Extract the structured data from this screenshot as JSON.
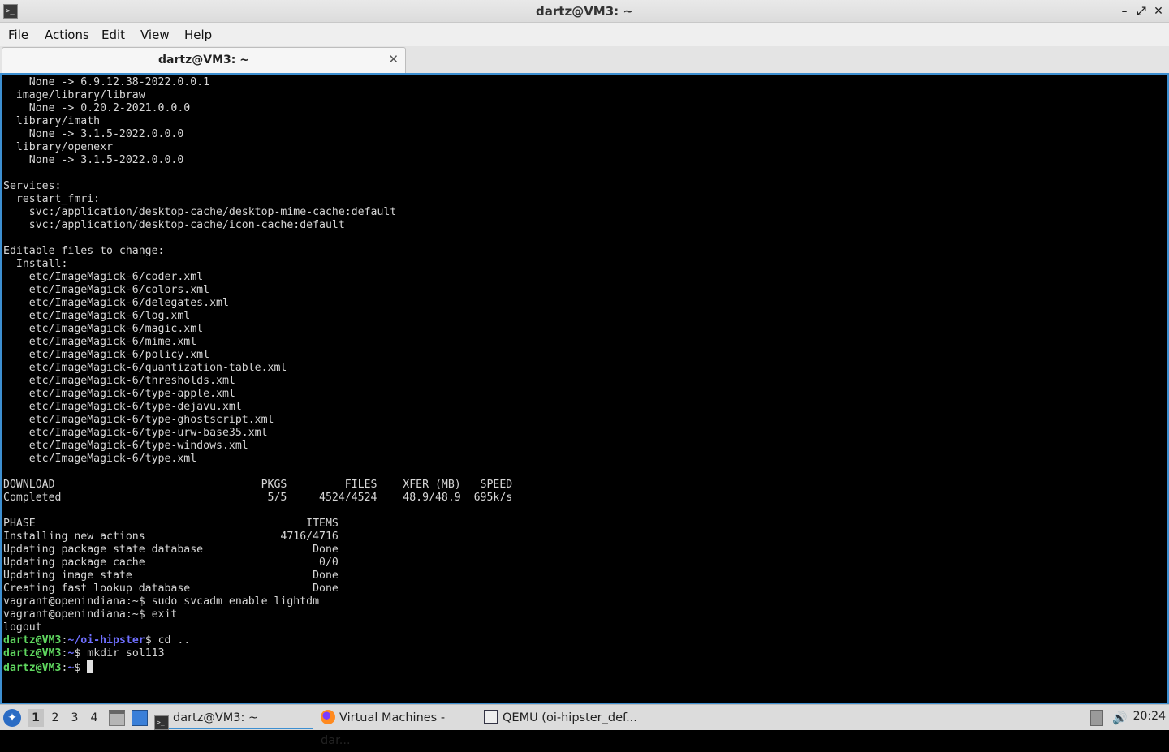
{
  "window": {
    "title": "dartz@VM3: ~",
    "app_icon": "terminal-icon",
    "buttons": {
      "minimize": "–",
      "maximize": "⤢",
      "close": "✕"
    }
  },
  "menu": [
    "File",
    "Actions",
    "Edit",
    "View",
    "Help"
  ],
  "tab": {
    "label": "dartz@VM3: ~",
    "close": "✕"
  },
  "terminal": {
    "lines": [
      "    None -> 6.9.12.38-2022.0.0.1",
      "  image/library/libraw",
      "    None -> 0.20.2-2021.0.0.0",
      "  library/imath",
      "    None -> 3.1.5-2022.0.0.0",
      "  library/openexr",
      "    None -> 3.1.5-2022.0.0.0",
      "",
      "Services:",
      "  restart_fmri:",
      "    svc:/application/desktop-cache/desktop-mime-cache:default",
      "    svc:/application/desktop-cache/icon-cache:default",
      "",
      "Editable files to change:",
      "  Install:",
      "    etc/ImageMagick-6/coder.xml",
      "    etc/ImageMagick-6/colors.xml",
      "    etc/ImageMagick-6/delegates.xml",
      "    etc/ImageMagick-6/log.xml",
      "    etc/ImageMagick-6/magic.xml",
      "    etc/ImageMagick-6/mime.xml",
      "    etc/ImageMagick-6/policy.xml",
      "    etc/ImageMagick-6/quantization-table.xml",
      "    etc/ImageMagick-6/thresholds.xml",
      "    etc/ImageMagick-6/type-apple.xml",
      "    etc/ImageMagick-6/type-dejavu.xml",
      "    etc/ImageMagick-6/type-ghostscript.xml",
      "    etc/ImageMagick-6/type-urw-base35.xml",
      "    etc/ImageMagick-6/type-windows.xml",
      "    etc/ImageMagick-6/type.xml",
      "",
      "DOWNLOAD                                PKGS         FILES    XFER (MB)   SPEED",
      "Completed                                5/5     4524/4524    48.9/48.9  695k/s",
      "",
      "PHASE                                          ITEMS",
      "Installing new actions                     4716/4716",
      "Updating package state database                 Done",
      "Updating package cache                           0/0",
      "Updating image state                            Done",
      "Creating fast lookup database                   Done",
      "vagrant@openindiana:~$ sudo svcadm enable lightdm",
      "vagrant@openindiana:~$ exit",
      "logout"
    ],
    "prompts": [
      {
        "user": "dartz@VM3",
        "path": "~/oi-hipster",
        "cmd": " cd .."
      },
      {
        "user": "dartz@VM3",
        "path": "~",
        "cmd": " mkdir sol113"
      },
      {
        "user": "dartz@VM3",
        "path": "~",
        "cmd": " "
      }
    ]
  },
  "taskbar": {
    "start_icon": "lxqt-menu-icon",
    "workspaces": [
      "1",
      "2",
      "3",
      "4"
    ],
    "active_workspace": "1",
    "quicklaunch": [
      "file-manager-icon",
      "show-desktop-icon"
    ],
    "tasks": [
      {
        "label": "dartz@VM3: ~",
        "icon": "terminal-icon",
        "active": true
      },
      {
        "label": "Virtual Machines - dar...",
        "icon": "firefox-icon",
        "active": false
      },
      {
        "label": "QEMU (oi-hipster_def...",
        "icon": "qemu-icon",
        "active": false
      }
    ],
    "tray": [
      "clipboard-icon",
      "volume-icon"
    ],
    "clock": "20:24"
  }
}
